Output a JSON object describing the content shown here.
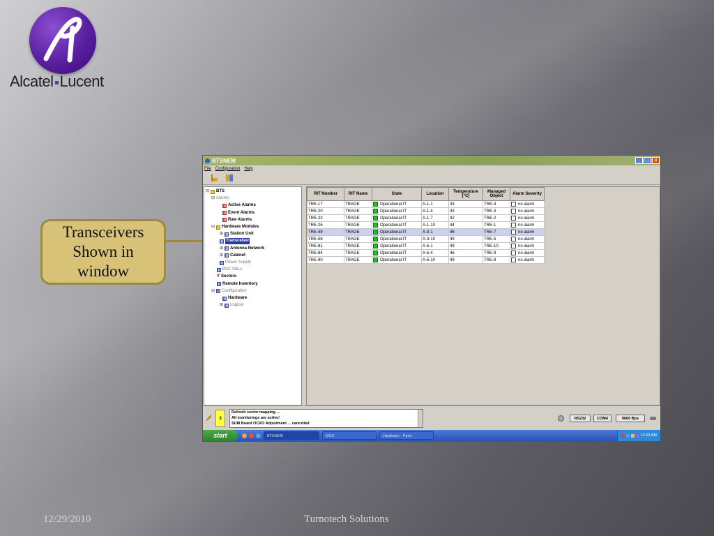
{
  "slide": {
    "brand_name": "Alcatel·Lucent",
    "brand_part1": "Alcatel",
    "brand_part2": "Lucent",
    "callout_line1": "Transceivers",
    "callout_line2": "Shown in",
    "callout_line3": "window",
    "footer_date": "12/29/2010",
    "footer_company": "Turnotech Solutions"
  },
  "window": {
    "title": "BTSNEM",
    "menu": [
      "File",
      "Configuration",
      "Help"
    ]
  },
  "tree": {
    "items": [
      {
        "label": "BTS",
        "style": "bold"
      },
      {
        "label": "Alarms",
        "style": "grey"
      },
      {
        "label": "Active Alarms",
        "style": "bold"
      },
      {
        "label": "Event Alarms",
        "style": "bold"
      },
      {
        "label": "Raw Alarms",
        "style": "bold"
      },
      {
        "label": "Hardware Modules",
        "style": "bold"
      },
      {
        "label": "Station Unit",
        "style": "bold"
      },
      {
        "label": "Transceiver",
        "style": "bold"
      },
      {
        "label": "Antenna Network",
        "style": "bold"
      },
      {
        "label": "Cabinet",
        "style": "bold"
      },
      {
        "label": "Power Supply",
        "style": "grey"
      },
      {
        "label": "BSC SBLs",
        "style": "grey"
      },
      {
        "label": "Sectors",
        "style": "bold"
      },
      {
        "label": "Remote Inventory",
        "style": "bold"
      },
      {
        "label": "Configuration",
        "style": "grey"
      },
      {
        "label": "Hardware",
        "style": "bold"
      },
      {
        "label": "Logical",
        "style": "grey"
      }
    ]
  },
  "table": {
    "headers": [
      "RIT Number",
      "RIT Name",
      "State",
      "Location",
      "Temperature [°C]",
      "Managed Object",
      "Alarm Severity"
    ],
    "rows": [
      [
        "TRE-17",
        "TRAGE",
        "Operational:IT",
        "A-1-1",
        "43",
        "TRE-4",
        "no alarm"
      ],
      [
        "TRE-20",
        "TRAGE",
        "Operational:IT",
        "A-1-4",
        "43",
        "TRE-3",
        "no alarm"
      ],
      [
        "TRE-23",
        "TRAGE",
        "Operational:IT",
        "A-1-7",
        "42",
        "TRE-2",
        "no alarm"
      ],
      [
        "TRE-26",
        "TRAGE",
        "Operational:IT",
        "A-1-10",
        "44",
        "TRE-1",
        "no alarm"
      ],
      [
        "TRE-49",
        "TRAGE",
        "Operational:IT",
        "A-3-1",
        "46",
        "TRE-7",
        "no alarm"
      ],
      [
        "TRE-58",
        "TRAGE",
        "Operational:IT",
        "A-3-10",
        "49",
        "TRE-5",
        "no alarm"
      ],
      [
        "TRE-81",
        "TRAGE",
        "Operational:IT",
        "A-5-1",
        "49",
        "TRE-10",
        "no alarm"
      ],
      [
        "TRE-84",
        "TRAGE",
        "Operational:IT",
        "A-5-4",
        "46",
        "TRE-9",
        "no alarm"
      ],
      [
        "TRE-90",
        "TRAGE",
        "Operational:IT",
        "A-5-10",
        "49",
        "TRE-8",
        "no alarm"
      ]
    ],
    "highlighted_row": 4
  },
  "status": {
    "alarm_count": "3",
    "messages": [
      "Refresh sector mapping ...",
      "All monitorings are active!",
      "SUM Board OCXO Adjustment ... cancelled"
    ],
    "port_type": "RS232",
    "port_name": "COM4",
    "baud_rate": "9600 Bps"
  },
  "taskbar": {
    "start_label": "start",
    "tasks": [
      "BTSNEM",
      "6415",
      "Hardware - Paint"
    ],
    "clock": "12:23 AM"
  },
  "colors": {
    "logo_purple": "#5a1fa0",
    "callout_fill": "#d8c277",
    "titlebar_green": "#8aa058",
    "state_green": "#22c022",
    "selection_row": "#cdd0ee"
  }
}
